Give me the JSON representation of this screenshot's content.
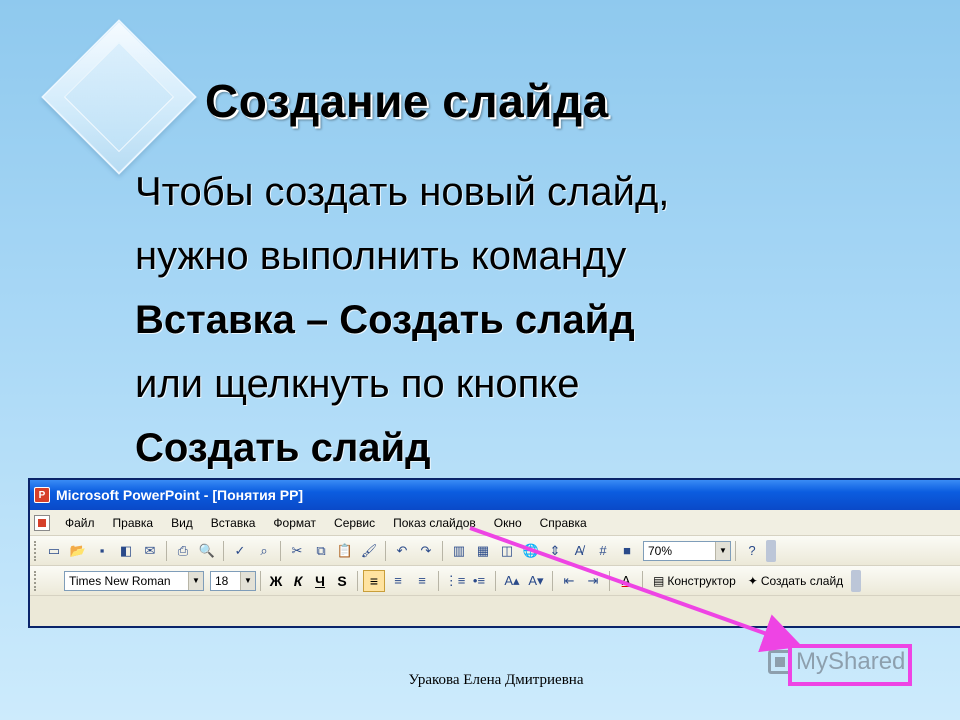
{
  "slide": {
    "title": "Создание слайда",
    "body_lines": [
      "Чтобы создать новый слайд,",
      "нужно выполнить команду",
      "Вставка – Создать слайд",
      "или щелкнуть по кнопке",
      "Создать слайд"
    ],
    "footer": "Уракова Елена Дмитриевна"
  },
  "app": {
    "title": "Microsoft PowerPoint - [Понятия PP]",
    "menu": [
      "Файл",
      "Правка",
      "Вид",
      "Вставка",
      "Формат",
      "Сервис",
      "Показ слайдов",
      "Окно",
      "Справка"
    ],
    "zoom": "70%",
    "font_name": "Times New Roman",
    "font_size": "18",
    "format_buttons": [
      "Ж",
      "К",
      "Ч",
      "S"
    ],
    "designer_label": "Конструктор",
    "new_slide_label": "Создать слайд"
  },
  "watermark": "MyShared",
  "colors": {
    "annotation": "#ee44e4",
    "titlebar": "#0b5de0"
  }
}
